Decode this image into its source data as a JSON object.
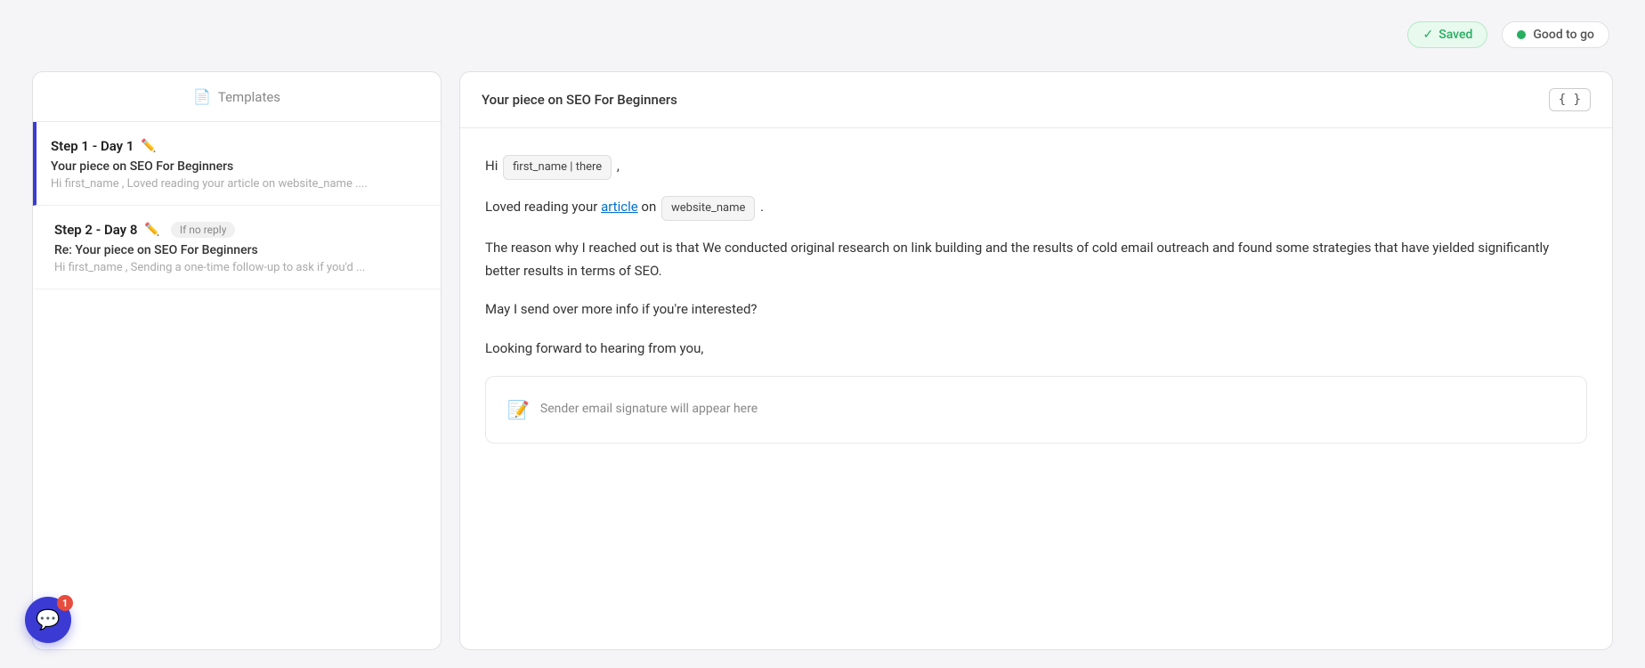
{
  "topbar": {
    "saved_label": "Saved",
    "good_to_go_label": "Good to go",
    "checkmark": "✓"
  },
  "left_panel": {
    "header_label": "Templates",
    "steps": [
      {
        "id": "step1",
        "title": "Step 1 - Day 1",
        "subject": "Your piece on SEO For Beginners",
        "preview": "Hi first_name , Loved reading your article on website_name ....",
        "active": true,
        "badge": null
      },
      {
        "id": "step2",
        "title": "Step 2 - Day 8",
        "subject": "Re: Your piece on SEO For Beginners",
        "preview": "Hi first_name , Sending a one-time follow-up to ask if you'd ...",
        "active": false,
        "badge": "If no reply"
      }
    ]
  },
  "right_panel": {
    "email_subject": "Your piece on SEO For Beginners",
    "curly_braces_label": "{ }",
    "body": {
      "greeting_prefix": "Hi",
      "greeting_variable": "first_name | there",
      "greeting_suffix": ",",
      "line1_prefix": "Loved reading your",
      "line1_link": "article",
      "line1_middle": "on",
      "line1_variable": "website_name",
      "line1_suffix": ".",
      "paragraph1": "The reason why I reached out is that We conducted original research on link building and the results of cold email outreach and found some strategies that have yielded significantly better results in terms of SEO.",
      "paragraph2": "May I send over more info if you're interested?",
      "paragraph3": "Looking forward to hearing from you,",
      "signature_label": "Sender email signature will appear here"
    }
  },
  "chat": {
    "icon": "💬",
    "badge": "1"
  }
}
